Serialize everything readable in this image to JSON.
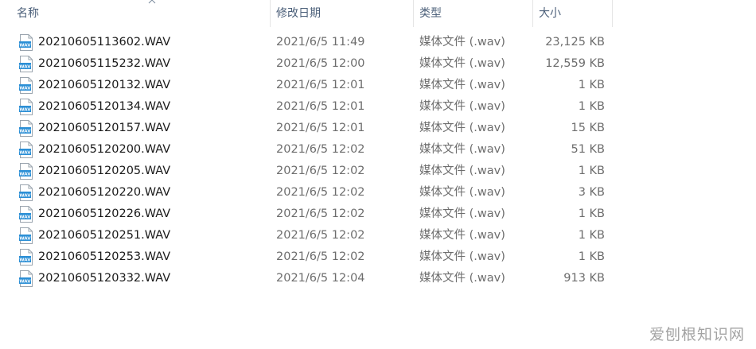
{
  "header": {
    "name_label": "名称",
    "date_label": "修改日期",
    "type_label": "类型",
    "size_label": "大小",
    "sort_icon": "chevron-up-icon"
  },
  "file_icon": {
    "name": "wav-file-icon",
    "badge_text": "WAV",
    "accent": "#2b8fd6"
  },
  "files": [
    {
      "name": "20210605113602.WAV",
      "date": "2021/6/5 11:49",
      "type": "媒体文件 (.wav)",
      "size": "23,125 KB"
    },
    {
      "name": "20210605115232.WAV",
      "date": "2021/6/5 12:00",
      "type": "媒体文件 (.wav)",
      "size": "12,559 KB"
    },
    {
      "name": "20210605120132.WAV",
      "date": "2021/6/5 12:01",
      "type": "媒体文件 (.wav)",
      "size": "1 KB"
    },
    {
      "name": "20210605120134.WAV",
      "date": "2021/6/5 12:01",
      "type": "媒体文件 (.wav)",
      "size": "1 KB"
    },
    {
      "name": "20210605120157.WAV",
      "date": "2021/6/5 12:01",
      "type": "媒体文件 (.wav)",
      "size": "15 KB"
    },
    {
      "name": "20210605120200.WAV",
      "date": "2021/6/5 12:02",
      "type": "媒体文件 (.wav)",
      "size": "51 KB"
    },
    {
      "name": "20210605120205.WAV",
      "date": "2021/6/5 12:02",
      "type": "媒体文件 (.wav)",
      "size": "1 KB"
    },
    {
      "name": "20210605120220.WAV",
      "date": "2021/6/5 12:02",
      "type": "媒体文件 (.wav)",
      "size": "3 KB"
    },
    {
      "name": "20210605120226.WAV",
      "date": "2021/6/5 12:02",
      "type": "媒体文件 (.wav)",
      "size": "1 KB"
    },
    {
      "name": "20210605120251.WAV",
      "date": "2021/6/5 12:02",
      "type": "媒体文件 (.wav)",
      "size": "1 KB"
    },
    {
      "name": "20210605120253.WAV",
      "date": "2021/6/5 12:02",
      "type": "媒体文件 (.wav)",
      "size": "1 KB"
    },
    {
      "name": "20210605120332.WAV",
      "date": "2021/6/5 12:04",
      "type": "媒体文件 (.wav)",
      "size": "913 KB"
    }
  ],
  "watermark": "爱刨根知识网"
}
